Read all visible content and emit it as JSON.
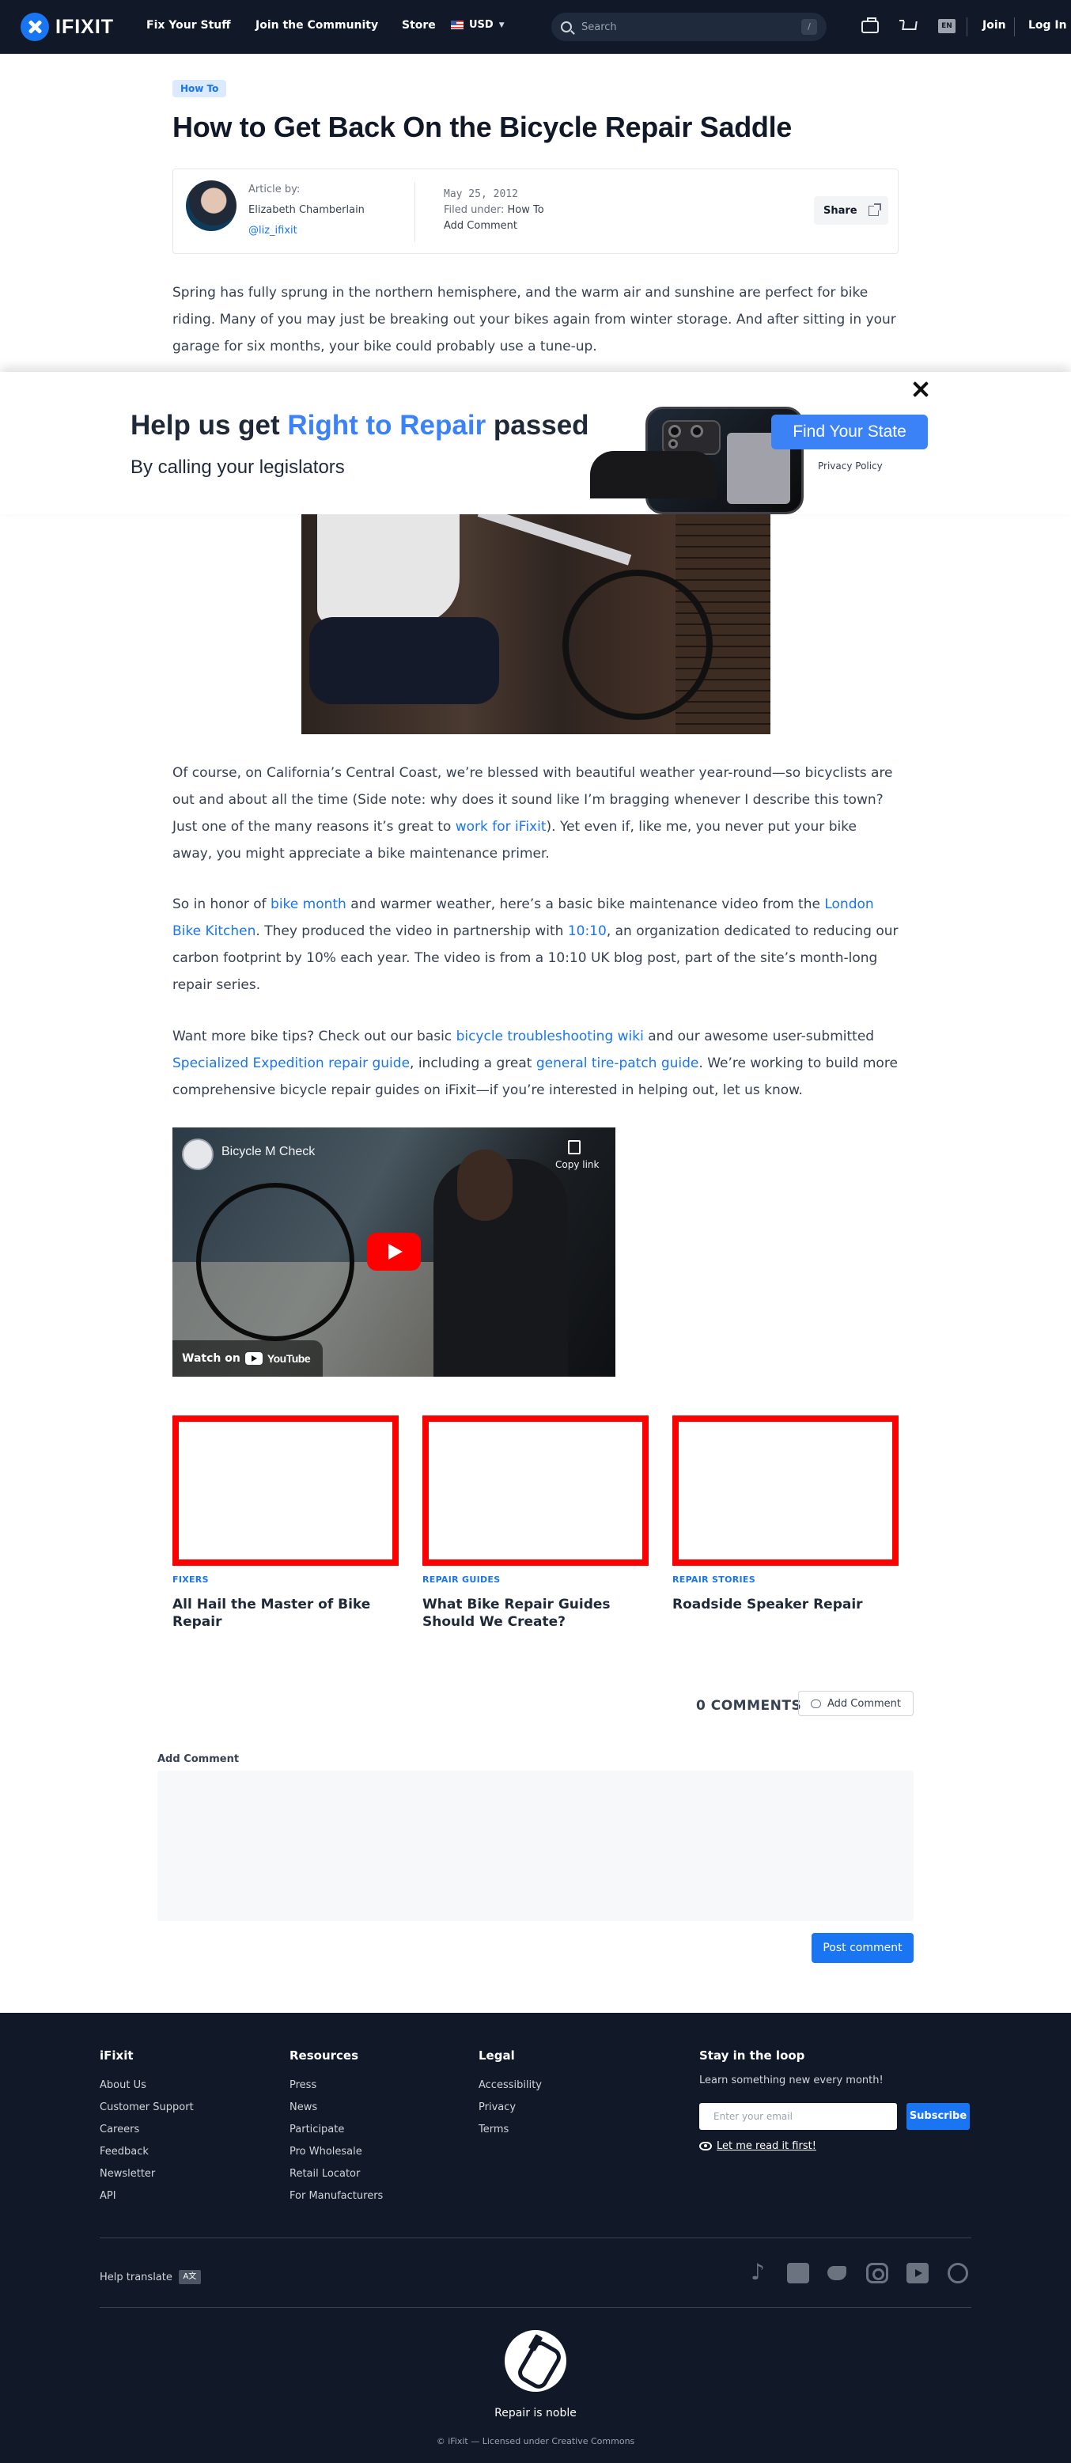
{
  "header": {
    "brand": "IFIXIT",
    "nav": [
      "Fix Your Stuff",
      "Join the Community",
      "Store"
    ],
    "currency": "USD",
    "search_placeholder": "Search",
    "search_shortcut": "/",
    "language": "EN",
    "join": "Join",
    "login": "Log In"
  },
  "article": {
    "tag": "How To",
    "title": "How to Get Back On the Bicycle Repair Saddle",
    "author_label": "Article by:",
    "author_name": "Elizabeth Chamberlain",
    "author_handle": "@liz_ifixit",
    "date": "May 25, 2012",
    "filed_label": "Filed under:",
    "filed_value": "How To",
    "add_comment": "Add Comment",
    "share": "Share",
    "p1": "Spring has fully sprung in the northern hemisphere, and the warm air and sunshine are perfect for bike riding. Many of you may just be breaking out your bikes again from winter storage. And after sitting in your garage for six months, your bike could probably use a tune-up.",
    "p2": {
      "a": "Of course, on California’s Central Coast, we’re blessed with beautiful weather year-round—so bicyclists are out and about all the time (Side note: why does it sound like I’m bragging whenever I describe this town? Just one of the many reasons it’s great to ",
      "link1": "work for iFixit",
      "b": "). Yet even if, like me, you never put your bike away, you might appreciate a bike maintenance primer."
    },
    "p3": {
      "a": "So in honor of ",
      "link1": "bike month",
      "b": " and warmer weather, here’s a basic bike maintenance video from the ",
      "link2": "London Bike Kitchen",
      "c": ". They produced the video in partnership with ",
      "link3": "10:10",
      "d": ", an organization dedicated to reducing our carbon footprint by 10% each year. The video is from a 10:10 UK blog post, part of the site’s month-long repair series."
    },
    "p4": {
      "a": "Want more bike tips? Check out our basic ",
      "link1": "bicycle troubleshooting wiki",
      "b": " and our awesome user-submitted ",
      "link2": "Specialized Expedition repair guide",
      "c": ", including a great ",
      "link3": "general tire-patch guide",
      "d": ". We’re working to build more comprehensive bicycle repair guides on iFixit—if you’re interested in helping out, let us know."
    }
  },
  "banner": {
    "head_a": "Help us get ",
    "head_highlight": "Right to Repair",
    "head_b": " passed",
    "subhead": "By calling your legislators",
    "cta": "Find Your State",
    "privacy": "Privacy Policy"
  },
  "video": {
    "title": "Bicycle M Check",
    "copy_link": "Copy link",
    "watch_on": "Watch on",
    "youtube": "YouTube"
  },
  "related": [
    {
      "category": "FIXERS",
      "title": "All Hail the Master of Bike Repair"
    },
    {
      "category": "REPAIR GUIDES",
      "title": "What Bike Repair Guides Should We Create?"
    },
    {
      "category": "REPAIR STORIES",
      "title": "Roadside Speaker Repair"
    }
  ],
  "comments": {
    "count_label": "0 COMMENTS",
    "add_button": "Add Comment",
    "add_label": "Add Comment",
    "post_button": "Post comment"
  },
  "footer": {
    "col1": {
      "title": "iFixit",
      "items": [
        "About Us",
        "Customer Support",
        "Careers",
        "Feedback",
        "Newsletter",
        "API"
      ]
    },
    "col2": {
      "title": "Resources",
      "items": [
        "Press",
        "News",
        "Participate",
        "Pro Wholesale",
        "Retail Locator",
        "For Manufacturers"
      ]
    },
    "col3": {
      "title": "Legal",
      "items": [
        "Accessibility",
        "Privacy",
        "Terms"
      ]
    },
    "newsletter": {
      "title": "Stay in the loop",
      "tagline": "Learn something new every month!",
      "placeholder": "Enter your email",
      "subscribe": "Subscribe",
      "read_first": "Let me read it first!"
    },
    "help_translate": "Help translate",
    "translate_icon_text": "A文",
    "noble": "Repair is noble",
    "copyright": "© iFixit — Licensed under Creative Commons"
  }
}
